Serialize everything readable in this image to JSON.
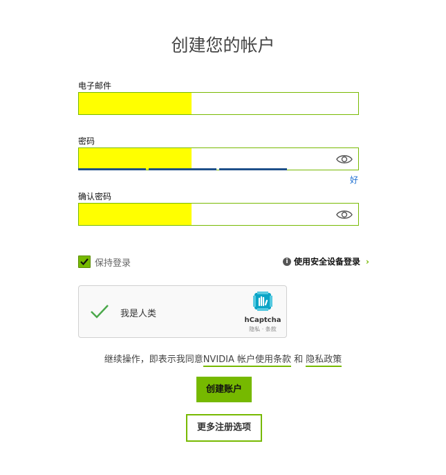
{
  "page": {
    "title": "创建您的帐户"
  },
  "form": {
    "email_label": "电子邮件",
    "email_value": "",
    "password_label": "密码",
    "password_value": "",
    "password_strength_text": "好",
    "password_strength_level": 0.75,
    "confirm_label": "确认密码",
    "confirm_value": ""
  },
  "options": {
    "remember_label": "保持登录",
    "remember_checked": true,
    "secure_login_label": "使用安全设备登录",
    "secure_login_chevron": "›",
    "info_icon": "i"
  },
  "captcha": {
    "label": "我是人类",
    "brand": "hCaptcha",
    "links": "隐私 · 条款"
  },
  "terms": {
    "prefix": "继续操作，即表示我同意",
    "terms_link": "NVIDIA 帐户使用条款",
    "connector": " 和 ",
    "privacy_link": "隐私政策"
  },
  "buttons": {
    "create": "创建账户",
    "more_options": "更多注册选项"
  },
  "colors": {
    "accent": "#76b900",
    "redaction": "#ffff00",
    "strength_bar": "#1d4e89",
    "strength_text": "#1d6fd1"
  }
}
